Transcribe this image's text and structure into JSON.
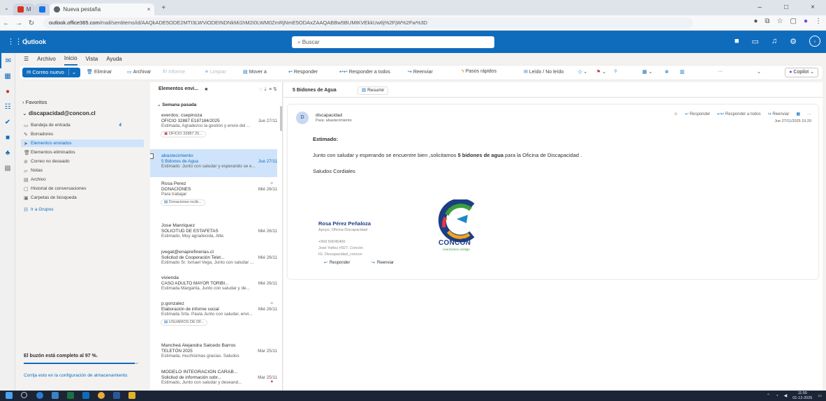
{
  "browser": {
    "tabs": [
      {
        "label": "M",
        "favicon_color": "#d93025"
      },
      {
        "label": "",
        "favicon_color": "#1a73e8"
      },
      {
        "label": "Nueva pestaña",
        "favicon_color": "#5f6368"
      }
    ],
    "new_tab": "+",
    "window_controls": [
      "–",
      "□",
      "×"
    ],
    "url_prefix": "outlook.office365.com",
    "url_rest": "/mail/sentitems/id/AAQkADE5ODE2MTI3LWViODEtNDNkMi1hM2I0LWM0ZmRjNmE5ODAxZAAQABBw5BUMtKVEkkUw6j%2FjW%2Fw%3D"
  },
  "app": {
    "name": "Outlook",
    "search_placeholder": "Buscar",
    "menu_tabs": [
      "Archivo",
      "Inicio",
      "Vista",
      "Ayuda"
    ],
    "selected_tab": "Inicio"
  },
  "ribbon": {
    "new_mail": "Correo nuevo",
    "buttons": [
      "Eliminar",
      "Archivar",
      "Informe",
      "Limpiar",
      "Mover a",
      "Responder",
      "Responder a todos",
      "Reenviar",
      "Pasos rápidos",
      "Leído / No leído"
    ],
    "copilot": "Copilot"
  },
  "folders": {
    "favorites": "Favoritos",
    "account": "discapacidad@concon.cl",
    "items": [
      {
        "label": "Bandeja de entrada",
        "count": "4",
        "icon": "inbox-icon",
        "selected": false
      },
      {
        "label": "Borradores",
        "count": "",
        "icon": "drafts-icon",
        "selected": false
      },
      {
        "label": "Elementos enviados",
        "count": "",
        "icon": "send-icon",
        "selected": true
      },
      {
        "label": "Elementos eliminados",
        "count": "",
        "icon": "trash-icon",
        "selected": false
      },
      {
        "label": "Correo no deseado",
        "count": "",
        "icon": "junk-icon",
        "selected": false
      },
      {
        "label": "Notas",
        "count": "",
        "icon": "notes-icon",
        "selected": false
      },
      {
        "label": "Archivo",
        "count": "",
        "icon": "archive-icon",
        "selected": false
      },
      {
        "label": "Historial de conversaciones",
        "count": "",
        "icon": "history-icon",
        "selected": false
      },
      {
        "label": "Carpetas de búsqueda",
        "count": "",
        "icon": "search-folder-icon",
        "selected": false
      },
      {
        "label": "Ir a Grupos",
        "count": "",
        "icon": "groups-icon",
        "selected": false
      }
    ],
    "storage_text": "El buzón está completo al 97 %.",
    "storage_fraction": 0.97,
    "storage_link": "Corrija esto en la configuración de almacenamiento."
  },
  "message_list": {
    "title": "Elementos envi...",
    "group": "Semana pasada",
    "messages": [
      {
        "from": "everdos; csepinoza",
        "subject": "OFICIO 32887 E187184/2025",
        "date": "Jue 27/11",
        "preview": "Estimada, Agradezco la gestión y envío del ...",
        "attachment": "OFICIO 32887 25...",
        "selected": false
      },
      {
        "from": "abastecimiento",
        "subject": "5 Bidones de Agua",
        "date": "Jue 27/11",
        "preview": "Estimado: Junto con saludar y esperando se e...",
        "attachment": "",
        "selected": true
      },
      {
        "from": "Rosa Perez",
        "subject": "DONACIONES",
        "date": "Mié 26/11",
        "preview": "Para trabajar",
        "attachment": "Donaciones recib...",
        "selected": false
      },
      {
        "from": "Jose Manriquez",
        "subject": "SOLICITUD DE ESTAFETAS",
        "date": "Mié 26/11",
        "preview": "Estimado, Muy agradecida, Atte.",
        "attachment": "",
        "selected": false
      },
      {
        "from": "jvegat@enaprefinerias.cl",
        "subject": "Solicitud de Cooperación Telet...",
        "date": "Mié 26/11",
        "preview": "Estimado Sr. Ismael Vega, Junto con saludar ...",
        "attachment": "",
        "selected": false
      },
      {
        "from": "vivienda",
        "subject": "CASO ADULTO MAYOR TORIBI...",
        "date": "Mié 26/11",
        "preview": "Estimada Margarita, Junto con saludar y de...",
        "attachment": "",
        "selected": false
      },
      {
        "from": "p.gonzalez",
        "subject": "Elaboración de informe social",
        "date": "Mié 26/11",
        "preview": "Estimada Srta. Paula Junto con saludar, envi...",
        "attachment": "USUARIOS DE DF...",
        "selected": false
      },
      {
        "from": "Mancheá Alejandra Salcedo Barros",
        "subject": "TELETÓN 2025",
        "date": "Mar 25/11",
        "preview": "Estimada, muchísimas gracias. Saludos",
        "attachment": "",
        "selected": false
      },
      {
        "from": "MODELO INTEGRACION CARAB...",
        "subject": "Solicitud de información sobr...",
        "date": "Mar 25/11",
        "preview": "Estimado, Junto con saludar y deseand...",
        "attachment": "",
        "selected": false
      }
    ]
  },
  "reading": {
    "subject": "5 Bidones de Agua",
    "summary": "Resumir",
    "sender_initials": "D",
    "sender": "discapacidad",
    "to": "Para: abastecimiento",
    "actions": [
      "Responder",
      "Responder a todos",
      "Reenviar"
    ],
    "date": "Jue 27/11/2025 15:29",
    "greeting": "Estimado:",
    "body_pre": "Junto con saludar y esperando se encuentre bien ,solicitamos ",
    "body_bold": "5 bidones de agua",
    "body_post": " para la Oficina de Discapacidad .",
    "closing": "Saludos Cordiales",
    "signature": {
      "name": "Rosa Pérez Peñaloza",
      "role": "Apoyo, Oficina Discapacidad",
      "phone": "+569 50045400",
      "address": "José Yañez #927, Concón",
      "social": "IG: Discapacidad_concon"
    },
    "logo_text": "CONCÓN",
    "logo_tagline": "avanzamos contigo",
    "reply": "Responder",
    "forward": "Reenviar"
  },
  "taskbar": {
    "time": "11:55",
    "date": "01-12-2025"
  }
}
